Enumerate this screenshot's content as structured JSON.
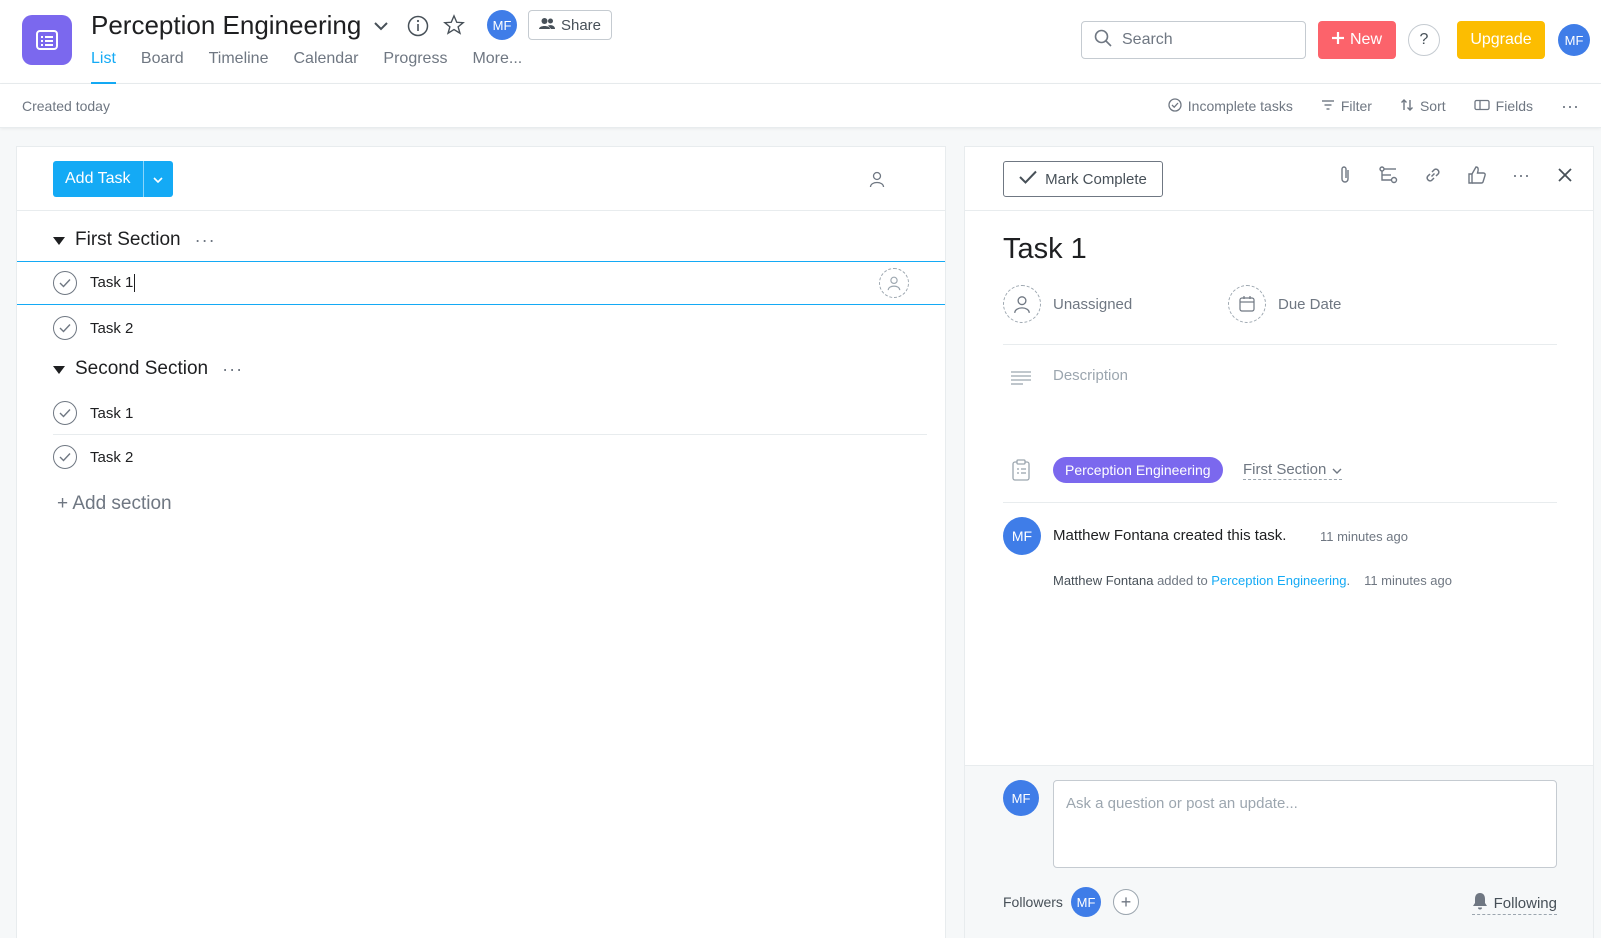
{
  "header": {
    "project_title": "Perception Engineering",
    "user_initials": "MF",
    "share_label": "Share",
    "tabs": [
      {
        "label": "List"
      },
      {
        "label": "Board"
      },
      {
        "label": "Timeline"
      },
      {
        "label": "Calendar"
      },
      {
        "label": "Progress"
      },
      {
        "label": "More..."
      }
    ],
    "search_placeholder": "Search",
    "new_label": "New",
    "help_label": "?",
    "upgrade_label": "Upgrade"
  },
  "subbar": {
    "created_text": "Created today",
    "incomplete_label": "Incomplete tasks",
    "filter_label": "Filter",
    "sort_label": "Sort",
    "fields_label": "Fields",
    "more_label": "···"
  },
  "list": {
    "add_task_label": "Add Task",
    "sections": [
      {
        "name": "First Section",
        "dots": "···",
        "tasks": [
          {
            "name": "Task 1"
          },
          {
            "name": "Task 2"
          }
        ]
      },
      {
        "name": "Second Section",
        "dots": "···",
        "tasks": [
          {
            "name": "Task 1"
          },
          {
            "name": "Task 2"
          }
        ]
      }
    ],
    "add_section_label": "+ Add section"
  },
  "detail": {
    "mark_complete_label": "Mark Complete",
    "task_title": "Task 1",
    "assignee_label": "Unassigned",
    "due_date_label": "Due Date",
    "description_placeholder": "Description",
    "project_pill": "Perception Engineering",
    "section_select": "First Section",
    "activity": {
      "avatar": "MF",
      "created_text": "Matthew Fontana created this task.",
      "created_time": "11 minutes ago",
      "added_who": "Matthew Fontana",
      "added_mid": " added to ",
      "added_link": "Perception Engineering",
      "added_end": ".",
      "added_time": "11 minutes ago"
    },
    "comment_avatar": "MF",
    "comment_placeholder": "Ask a question or post an update...",
    "followers_label": "Followers",
    "follower_initials": "MF",
    "add_follower": "+",
    "following_label": "Following"
  },
  "colors": {
    "accent": "#14aaf5",
    "project": "#7b68ee",
    "new": "#fc636b",
    "upgrade": "#fcbd01",
    "avatar": "#3f7de8"
  }
}
